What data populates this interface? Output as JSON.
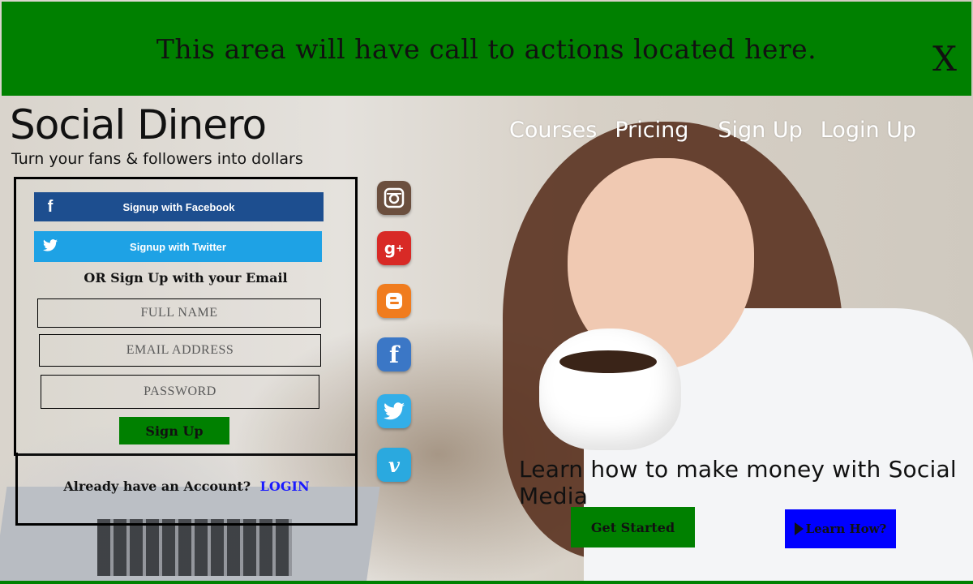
{
  "banner": {
    "text": "This area will have call to actions located here.",
    "close_label": "X"
  },
  "brand": {
    "title": "Social Dinero",
    "tagline": "Turn your fans & followers into dollars"
  },
  "nav": {
    "items": [
      "Courses",
      "Pricing",
      "Sign Up",
      "Login Up"
    ]
  },
  "signup": {
    "facebook_label": "Signup with Facebook",
    "twitter_label": "Signup with Twitter",
    "or_text": "OR Sign Up with your Email",
    "fullname_placeholder": "FULL NAME",
    "email_placeholder": "EMAIL ADDRESS",
    "password_placeholder": "PASSWORD",
    "submit_label": "Sign Up"
  },
  "login": {
    "prompt": "Already have an Account?",
    "link_label": "LOGIN"
  },
  "social_icons": [
    "instagram-icon",
    "google-plus-icon",
    "blogger-icon",
    "facebook-icon",
    "twitter-icon",
    "vimeo-icon"
  ],
  "hero": {
    "headline": "Learn how to make money with Social Media",
    "get_started_label": "Get Started",
    "learn_how_label": "Learn How?"
  },
  "colors": {
    "banner_green": "#008000",
    "facebook_blue": "#1d4e8f",
    "twitter_blue": "#1ea2e5",
    "learn_blue": "#0000ff",
    "login_link": "#1a1aff"
  }
}
